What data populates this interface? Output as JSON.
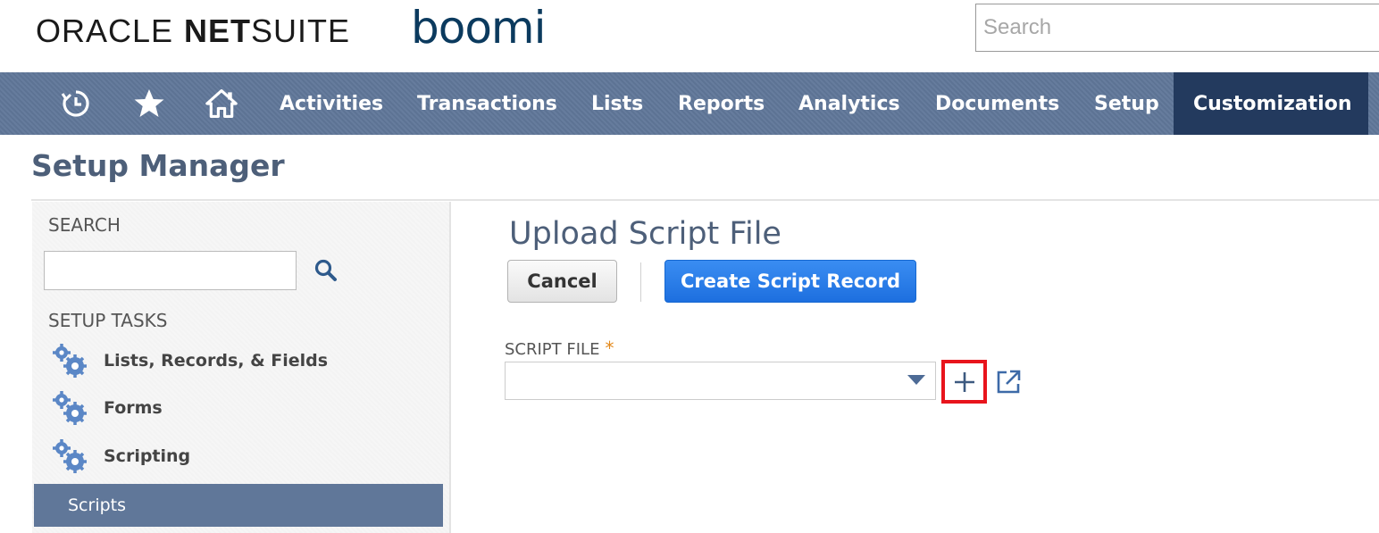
{
  "header": {
    "logo_oracle_part1": "ORACLE",
    "logo_oracle_part2": "NET",
    "logo_oracle_part3": "SUITE",
    "logo_boomi": "boomi",
    "search_placeholder": "Search"
  },
  "nav": {
    "icons": [
      "recent-icon",
      "star-icon",
      "home-icon"
    ],
    "items": [
      {
        "label": "Activities"
      },
      {
        "label": "Transactions"
      },
      {
        "label": "Lists"
      },
      {
        "label": "Reports"
      },
      {
        "label": "Analytics"
      },
      {
        "label": "Documents"
      },
      {
        "label": "Setup"
      },
      {
        "label": "Customization",
        "active": true
      }
    ],
    "active_color": "#233a5e",
    "bar_color": "#607799"
  },
  "page": {
    "title": "Setup Manager"
  },
  "sidebar": {
    "search_label": "SEARCH",
    "tasks_label": "SETUP TASKS",
    "tasks": [
      {
        "label": "Lists, Records, & Fields"
      },
      {
        "label": "Forms"
      },
      {
        "label": "Scripting"
      }
    ],
    "selected_item": "Scripts"
  },
  "main": {
    "title": "Upload Script File",
    "cancel_label": "Cancel",
    "create_label": "Create Script Record",
    "field_label": "SCRIPT FILE",
    "required_mark": "*",
    "primary_color": "#1d6fdf",
    "highlight_color": "#e8141c"
  }
}
